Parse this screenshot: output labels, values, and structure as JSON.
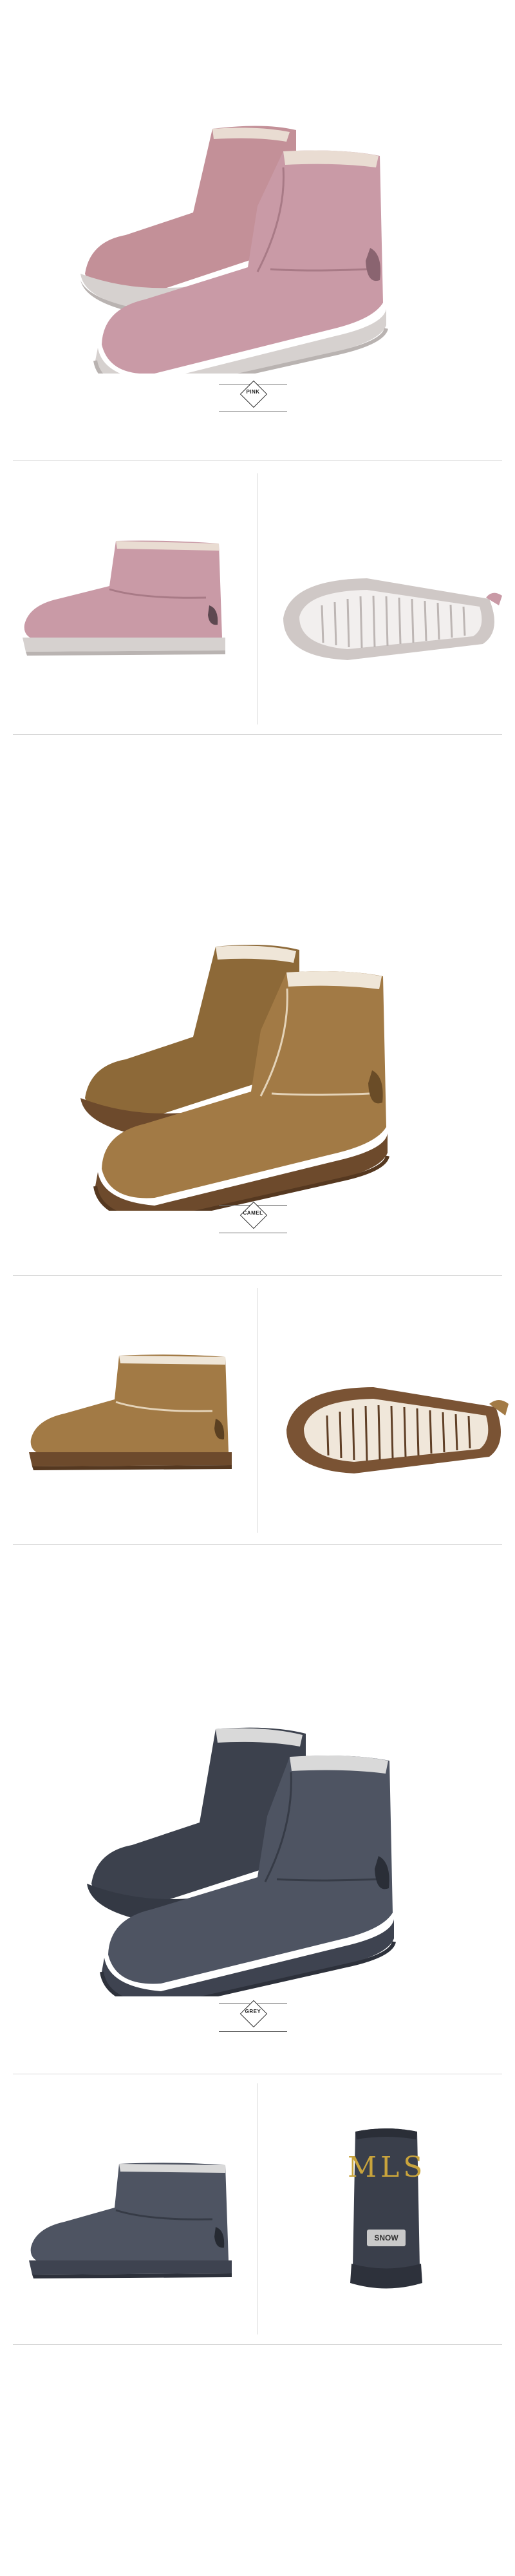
{
  "sections": [
    {
      "label": "PINK",
      "colors": {
        "upper": "#c99aa6",
        "shade": "#b58492",
        "dark": "#9e6f7c",
        "sole": "#d6d1cf",
        "soleDark": "#b9b3b1",
        "fur": "#e9dcd2"
      }
    },
    {
      "label": "CAMEL",
      "colors": {
        "upper": "#a27a45",
        "shade": "#8d6938",
        "dark": "#74552b",
        "sole": "#6d4a2c",
        "soleDark": "#553820",
        "fur": "#efe6d8"
      }
    },
    {
      "label": "GREY",
      "colors": {
        "upper": "#4e5462",
        "shade": "#424855",
        "dark": "#343944",
        "sole": "#3e4350",
        "soleDark": "#2d313b",
        "fur": "#d9d9d9"
      }
    }
  ],
  "grey_back": {
    "logo_text": "MLS",
    "tag_text": "SNOW"
  },
  "sole_colors": {
    "pink": {
      "rim": "#cfc8c6",
      "inner": "#f2efee",
      "tread": "#bdb6b4"
    },
    "camel": {
      "rim": "#7a5334",
      "inner": "#f0e7da",
      "tread": "#5f3f26"
    }
  }
}
